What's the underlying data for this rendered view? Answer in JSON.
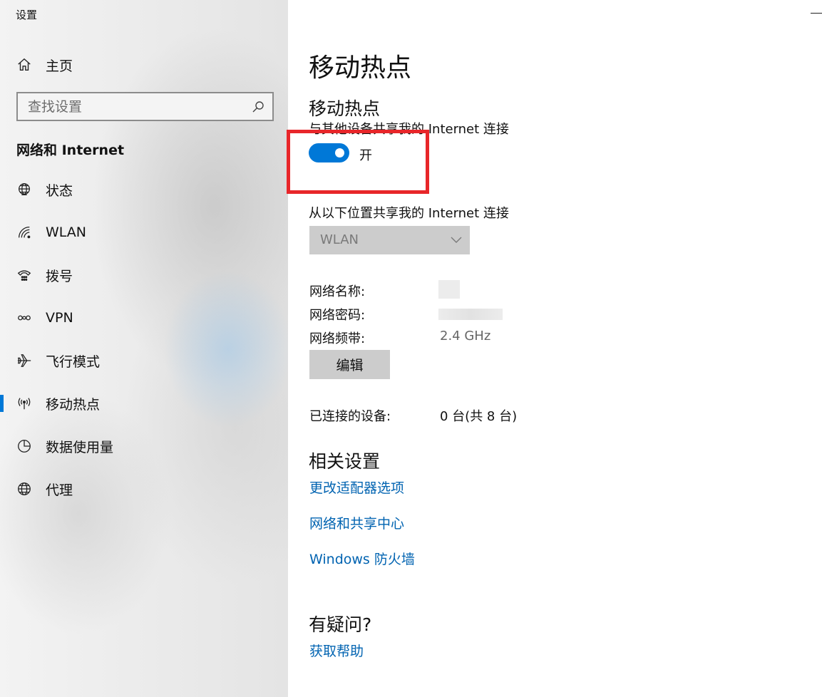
{
  "window": {
    "app_title": "设置"
  },
  "sidebar": {
    "home_label": "主页",
    "search_placeholder": "查找设置",
    "section_heading": "网络和 Internet",
    "items": [
      {
        "label": "状态",
        "icon": "globe-status-icon"
      },
      {
        "label": "WLAN",
        "icon": "wifi-icon"
      },
      {
        "label": "拨号",
        "icon": "dialup-icon"
      },
      {
        "label": "VPN",
        "icon": "vpn-icon"
      },
      {
        "label": "飞行模式",
        "icon": "airplane-icon"
      },
      {
        "label": "移动热点",
        "icon": "hotspot-icon",
        "selected": true
      },
      {
        "label": "数据使用量",
        "icon": "pie-chart-icon"
      },
      {
        "label": "代理",
        "icon": "globe-icon"
      }
    ]
  },
  "main": {
    "title": "移动热点",
    "section_title": "移动热点",
    "share_label": "与其他设备共享我的 Internet 连接",
    "toggle_state": "开",
    "toggle_on": true,
    "source_label": "从以下位置共享我的 Internet 连接",
    "source_select_value": "WLAN",
    "properties": {
      "network_name_label": "网络名称:",
      "network_password_label": "网络密码:",
      "network_band_label": "网络频带:",
      "network_band_value": "2.4 GHz"
    },
    "edit_button_label": "编辑",
    "connected_label": "已连接的设备:",
    "connected_value": "0 台(共 8 台)",
    "related_settings_title": "相关设置",
    "related_links": [
      "更改适配器选项",
      "网络和共享中心",
      "Windows 防火墙"
    ],
    "help_title": "有疑问?",
    "help_link": "获取帮助"
  },
  "colors": {
    "accent": "#0078d7",
    "link": "#0063b1",
    "highlight_box": "#e8262a"
  }
}
